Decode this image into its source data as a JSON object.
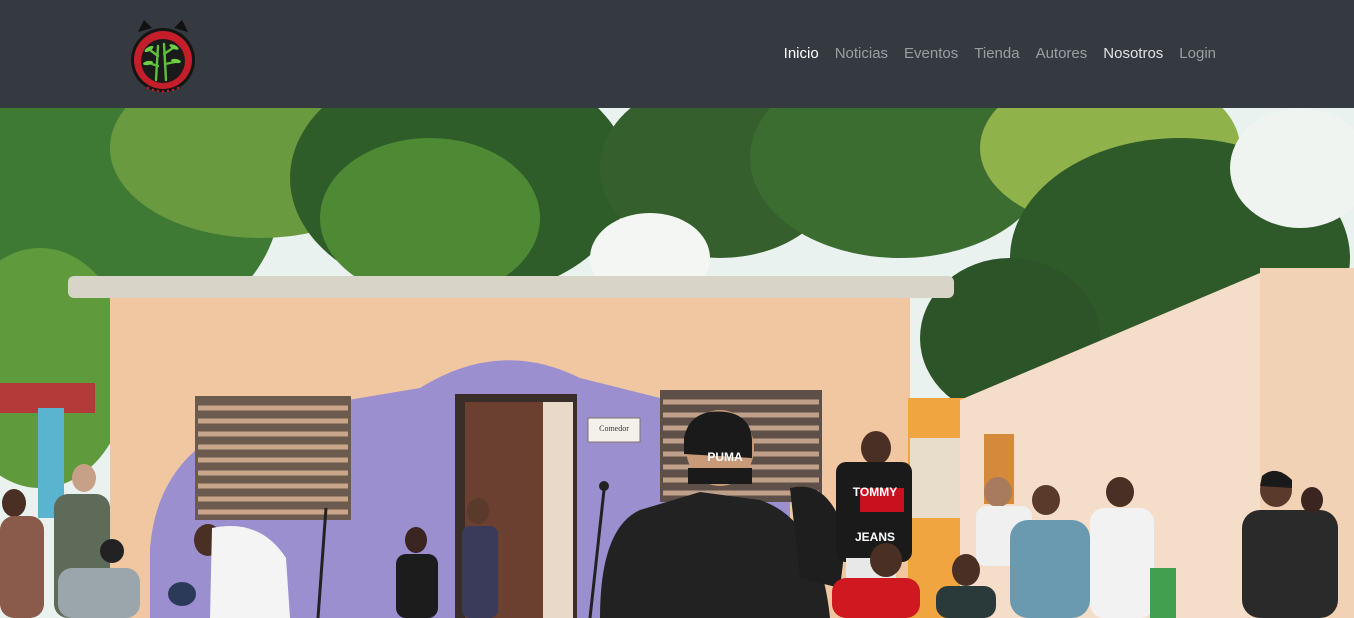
{
  "brand": {
    "logo_icon": "cat-bamboo-logo-icon"
  },
  "nav": {
    "items": [
      {
        "label": "Inicio",
        "state": "active"
      },
      {
        "label": "Noticias",
        "state": "muted"
      },
      {
        "label": "Eventos",
        "state": "muted"
      },
      {
        "label": "Tienda",
        "state": "muted"
      },
      {
        "label": "Autores",
        "state": "muted"
      },
      {
        "label": "Nosotros",
        "state": "bright"
      },
      {
        "label": "Login",
        "state": "muted"
      }
    ]
  },
  "hero": {
    "sign_text": "Comedor",
    "cap_text": "PUMA",
    "shirt_text_top": "TOMMY",
    "shirt_text_bottom": "JEANS",
    "colors": {
      "navbar": "#343a40",
      "wall": "#f0c7a0",
      "purple_wall": "#9b8fd0"
    }
  }
}
